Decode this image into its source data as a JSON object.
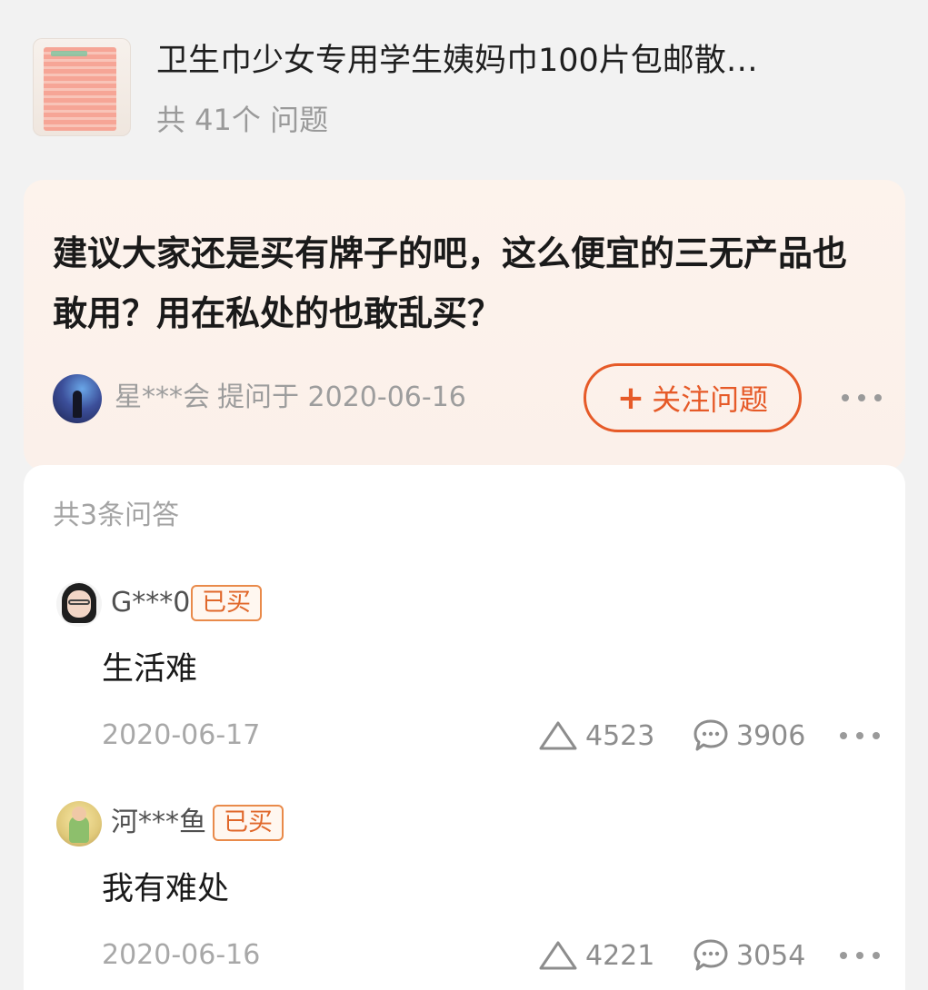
{
  "product": {
    "title": "卫生巾少女专用学生姨妈巾100片包邮散…",
    "question_count": "共 41个 问题"
  },
  "question": {
    "text": "建议大家还是买有牌子的吧，这么便宜的三无产品也敢用？用在私处的也敢乱买？",
    "asker": "星***会",
    "asked_label": "提问于 2020-06-16",
    "follow_label": "关注问题",
    "follow_icon": "plus-icon"
  },
  "answers": {
    "count_label": "共3条问答",
    "items": [
      {
        "user": "G***0",
        "badge": "已买",
        "text": "生活难",
        "date": "2020-06-17",
        "likes": "4523",
        "comments": "3906"
      },
      {
        "user": "河***鱼",
        "badge": "已买",
        "text": "我有难处",
        "date": "2020-06-16",
        "likes": "4221",
        "comments": "3054"
      }
    ]
  },
  "colors": {
    "accent": "#e65a28",
    "badge_border": "#e98a4a",
    "question_bg": "#fdf3ec",
    "page_bg": "#f2f2f2"
  },
  "icons": {
    "like": "triangle-up-icon",
    "comment": "speech-bubble-icon",
    "more": "more-dots-icon"
  }
}
